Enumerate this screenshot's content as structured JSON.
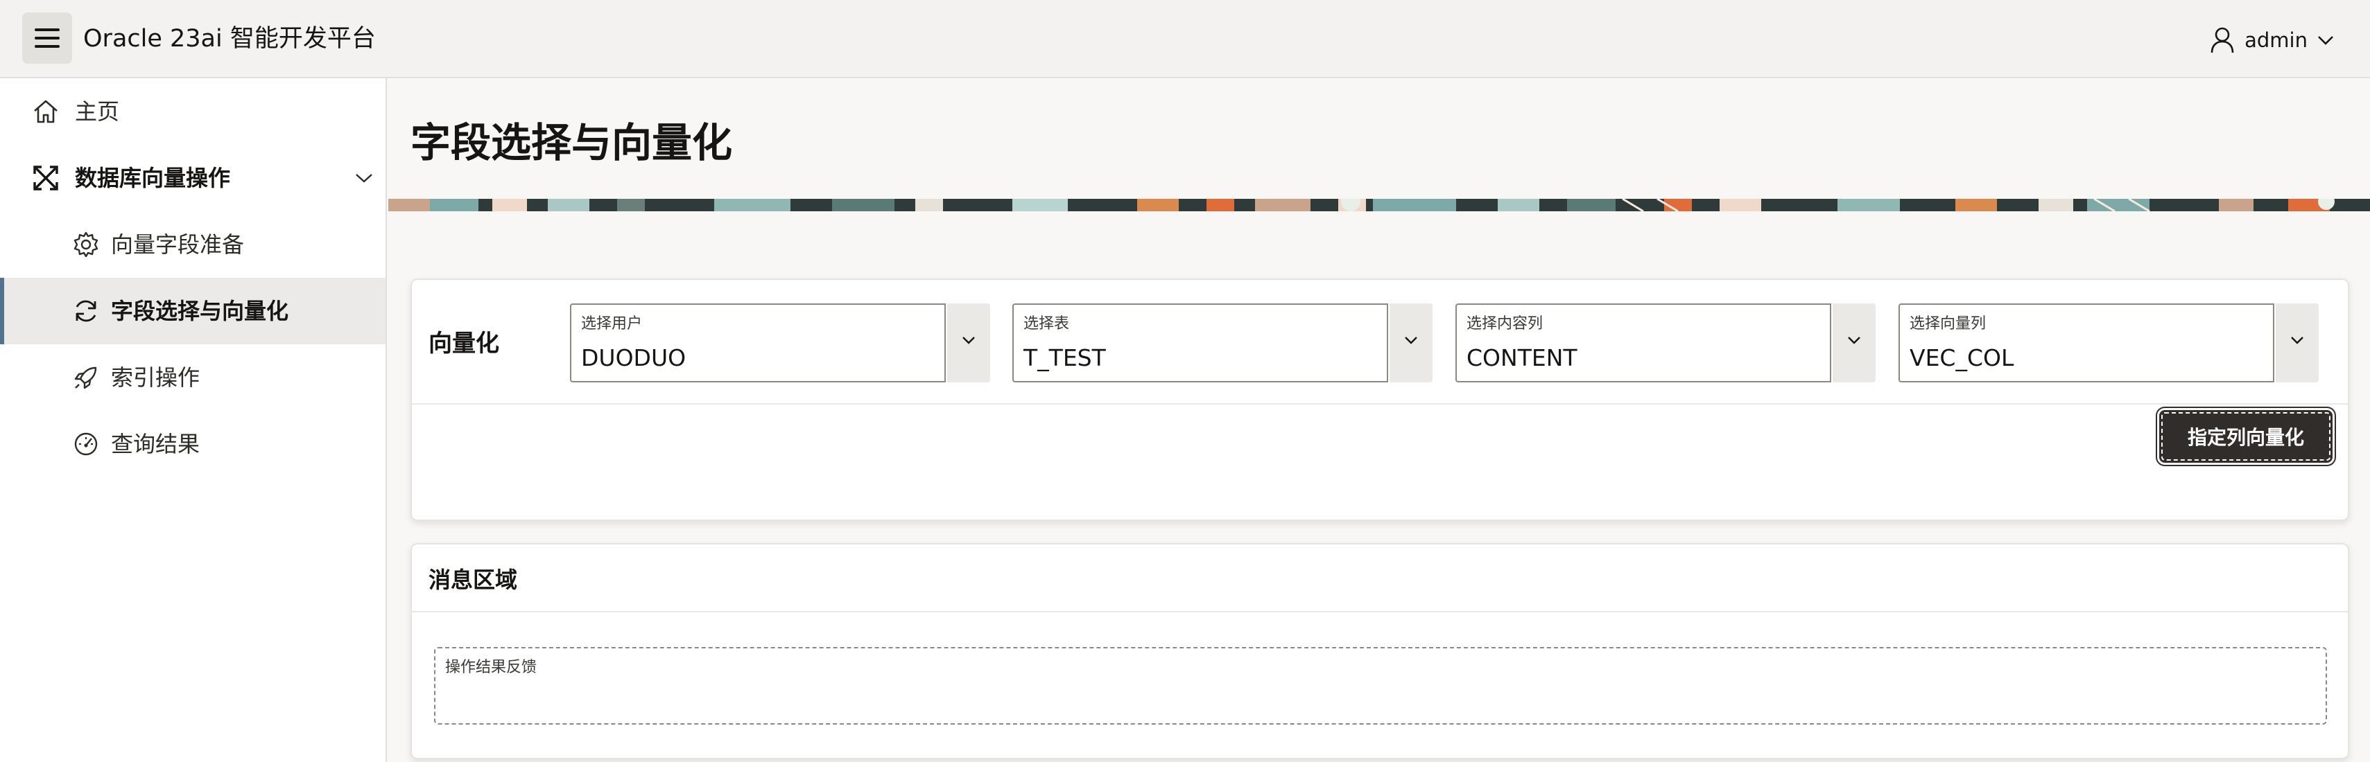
{
  "header": {
    "app_title": "Oracle 23ai 智能开发平台",
    "menu_icon": "hamburger-icon",
    "user_icon": "user-icon",
    "user_name": "admin"
  },
  "sidebar": {
    "items": [
      {
        "label": "主页",
        "icon": "home-icon"
      },
      {
        "label": "数据库向量操作",
        "icon": "expand-arrows-icon"
      },
      {
        "label": "向量字段准备",
        "icon": "gear-icon"
      },
      {
        "label": "字段选择与向量化",
        "icon": "refresh-icon"
      },
      {
        "label": "索引操作",
        "icon": "rocket-icon"
      },
      {
        "label": "查询结果",
        "icon": "gauge-icon"
      }
    ]
  },
  "page": {
    "title": "字段选择与向量化"
  },
  "vectorize_region": {
    "label": "向量化",
    "selects": [
      {
        "label": "选择用户",
        "value": "DUODUO"
      },
      {
        "label": "选择表",
        "value": "T_TEST"
      },
      {
        "label": "选择内容列",
        "value": "CONTENT"
      },
      {
        "label": "选择向量列",
        "value": "VEC_COL"
      }
    ],
    "button_label": "指定列向量化"
  },
  "message_region": {
    "title": "消息区域",
    "feedback_label": "操作结果反馈"
  },
  "colors": {
    "primary_button": "#312d2a",
    "active_nav_border": "#52728f",
    "header_bg": "#f3f2f0"
  }
}
